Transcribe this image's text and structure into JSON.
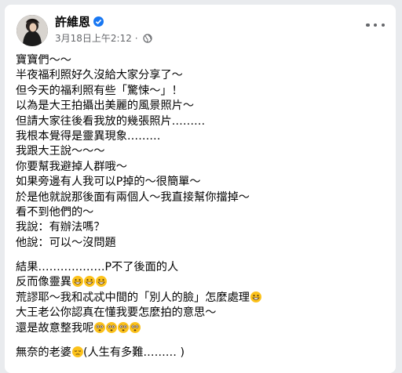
{
  "post": {
    "author_name": "許維恩",
    "timestamp": "3月18日上午2:12",
    "privacy_sep": "·",
    "lines_p1": [
      "寶寶們～～",
      "半夜福利照好久沒給大家分享了～",
      "但今天的福利照有些「驚悚～」！",
      "以為是大王拍攝出美麗的風景照片～",
      "但請大家往後看我放的幾張照片………",
      "我根本覺得是靈異現象………",
      "我跟大王說～～～",
      "你要幫我避掉人群哦～",
      "如果旁邊有人我可以P掉的～很簡單～",
      "於是他就說那後面有兩個人～我直接幫你擋掉～",
      "看不到他們的～",
      "我說：有辦法嗎？",
      "他說：可以～沒問題"
    ],
    "line_r1": "結果………………P不了後面的人",
    "line_r2": "反而像靈異",
    "line_r3": "荒謬耶～我和忒忒中間的「別人的臉」怎麼處理",
    "line_r4": "大王老公你認真在懂我要怎麼拍的意思～",
    "line_r5": "還是故意整我呢",
    "line_f1a": "無奈的老婆",
    "line_f1b": "(人生有多難……… )"
  },
  "icons": {
    "verified": "verified-badge-icon",
    "privacy": "globe-icon",
    "more": "more-options-icon",
    "emoji_grin": "grinning-face-icon",
    "emoji_flushed": "flushed-face-icon",
    "emoji_sad": "pensive-face-icon"
  },
  "colors": {
    "verified": "#1877f2",
    "emoji": "#fcc21b",
    "meta_text": "#65676b"
  }
}
